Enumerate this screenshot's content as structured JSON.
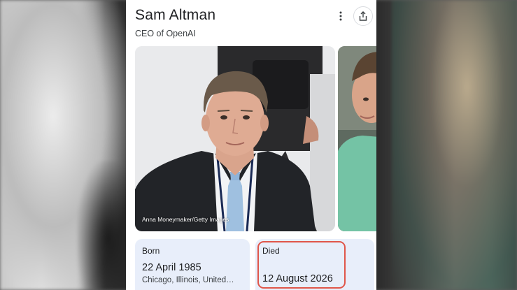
{
  "knowledge_panel": {
    "title": "Sam Altman",
    "subtitle": "CEO of OpenAI",
    "more_icon": "more-vert-icon",
    "share_icon": "share-icon"
  },
  "images": {
    "main_credit": "Anna Moneymaker/Getty Images"
  },
  "facts": {
    "born": {
      "label": "Born",
      "value": "22 April 1985",
      "place": "Chicago, Illinois, United…"
    },
    "died": {
      "label": "Died",
      "value": "12 August 2026"
    }
  },
  "colors": {
    "highlight": "#e0564a",
    "fact_bg": "#e8eefa"
  }
}
